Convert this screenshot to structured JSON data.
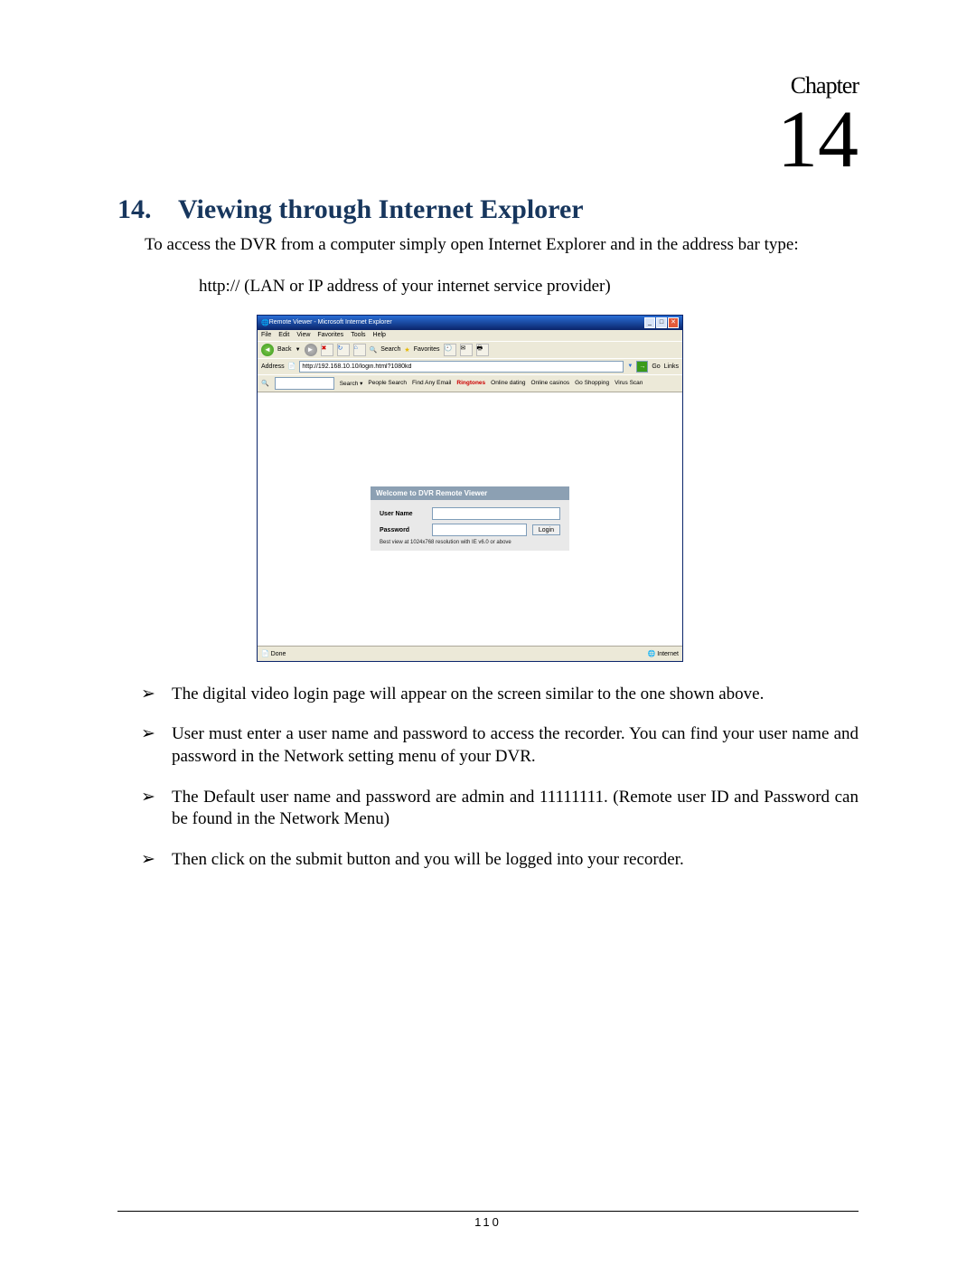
{
  "chapter": {
    "label": "Chapter",
    "number": "14"
  },
  "section": {
    "number": "14.",
    "title": "Viewing through Internet Explorer"
  },
  "intro": "To access the DVR from a computer simply open Internet Explorer and in the address bar type:",
  "url_hint": "http:// (LAN or IP address of your internet service provider)",
  "ie": {
    "title": "Remote Viewer - Microsoft Internet Explorer",
    "menu": [
      "File",
      "Edit",
      "View",
      "Favorites",
      "Tools",
      "Help"
    ],
    "toolbar": {
      "back": "Back",
      "search": "Search",
      "favorites": "Favorites"
    },
    "address_label": "Address",
    "address_value": "http://192.168.10.10/login.html?1080kd",
    "go": "Go",
    "links_label": "Links",
    "quickbar": {
      "search": "Search ▾",
      "items": [
        "People Search",
        "Find Any Email",
        "Ringtones",
        "Online dating",
        "Online casinos",
        "Go Shopping",
        "Virus Scan"
      ]
    },
    "login": {
      "header": "Welcome to DVR Remote Viewer",
      "user_label": "User Name",
      "pass_label": "Password",
      "button": "Login",
      "note": "Best view at 1024x768 resolution with IE v6.0 or above"
    },
    "status_left": "Done",
    "status_right": "Internet"
  },
  "bullets": [
    "The digital video login page will appear on the screen similar to the one shown above.",
    "User must enter a user name and password to access the recorder. You can find your user name and password in the Network setting menu of your DVR.",
    "The Default user name and password are admin and 11111111. (Remote user ID and Password can be found in the Network Menu)",
    "Then click on the submit button and you will be logged into your recorder."
  ],
  "page_number": "110"
}
